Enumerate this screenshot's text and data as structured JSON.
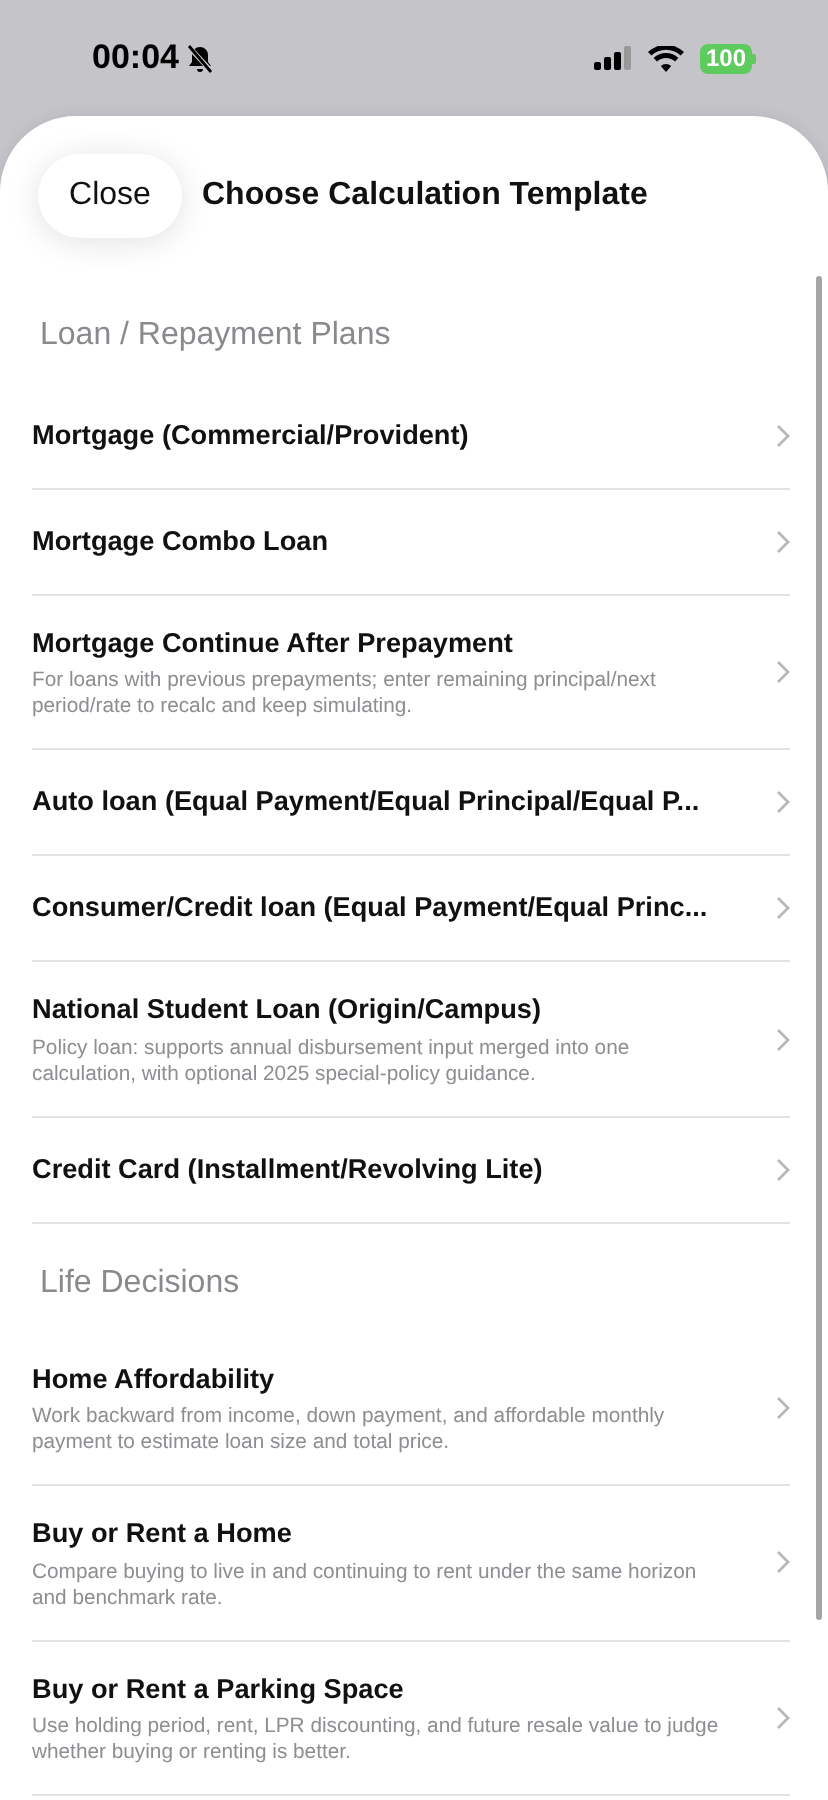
{
  "status_bar": {
    "time": "00:04",
    "battery": "100"
  },
  "header": {
    "close": "Close",
    "title": "Choose Calculation Template"
  },
  "sections": [
    {
      "title": "Loan / Repayment Plans",
      "items": [
        {
          "title": "Mortgage (Commercial/Provident)"
        },
        {
          "title": "Mortgage Combo Loan"
        },
        {
          "title": "Mortgage Continue After Prepayment",
          "description": "For loans with previous prepayments; enter remaining principal/next period/rate to recalc and keep simulating."
        },
        {
          "title": "Auto loan (Equal Payment/Equal Principal/Equal P..."
        },
        {
          "title": "Consumer/Credit loan (Equal Payment/Equal Princ..."
        },
        {
          "title": "National Student Loan (Origin/Campus)",
          "description": "Policy loan: supports annual disbursement input merged into one calculation, with optional 2025 special-policy guidance."
        },
        {
          "title": "Credit Card (Installment/Revolving Lite)"
        }
      ]
    },
    {
      "title": "Life Decisions",
      "items": [
        {
          "title": "Home Affordability",
          "description": "Work backward from income, down payment, and affordable monthly payment to estimate loan size and total price."
        },
        {
          "title": "Buy or Rent a Home",
          "description": "Compare buying to live in and continuing to rent under the same horizon and benchmark rate."
        },
        {
          "title": "Buy or Rent a Parking Space",
          "description": "Use holding period, rent, LPR discounting, and future resale value to judge whether buying or renting is better."
        }
      ]
    }
  ]
}
